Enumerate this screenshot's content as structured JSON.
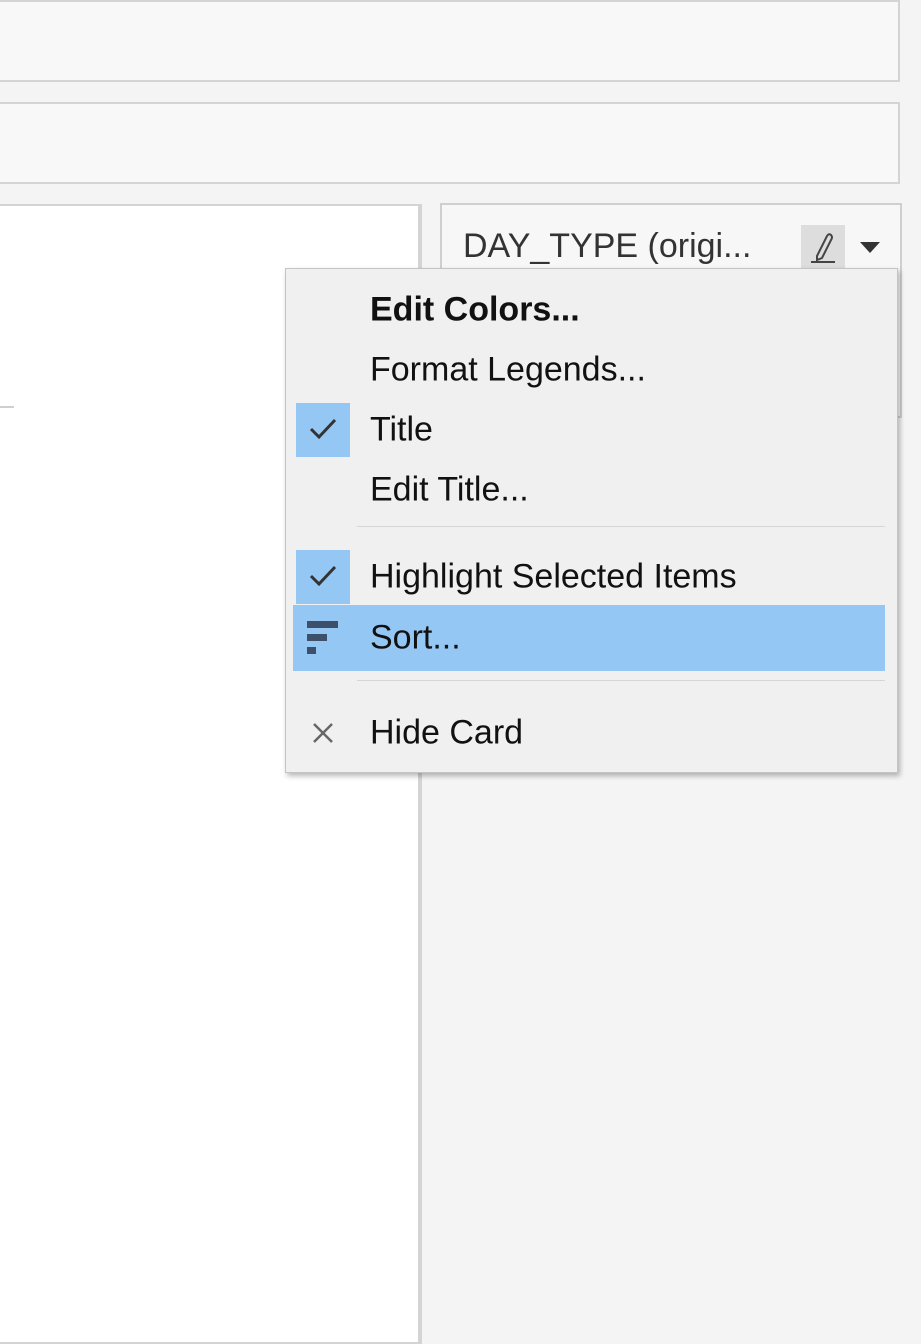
{
  "legend_card": {
    "title": "DAY_TYPE (origi..."
  },
  "context_menu": {
    "items": [
      {
        "label": "Edit Colors...",
        "bold": true,
        "checked": false
      },
      {
        "label": "Format Legends...",
        "bold": false,
        "checked": false
      },
      {
        "label": "Title",
        "bold": false,
        "checked": true
      },
      {
        "label": "Edit Title...",
        "bold": false,
        "checked": false
      },
      {
        "label": "Highlight Selected Items",
        "bold": false,
        "checked": true
      },
      {
        "label": "Sort...",
        "bold": false,
        "checked": false,
        "highlighted": true,
        "icon": "sort-icon"
      },
      {
        "label": "Hide Card",
        "bold": false,
        "checked": false,
        "icon": "close-icon"
      }
    ]
  },
  "colors": {
    "highlight": "#94c7f4",
    "menu_background": "#f0f0f0",
    "panel_background": "#f4f4f4",
    "sort_icon": "#3e4f6a"
  }
}
